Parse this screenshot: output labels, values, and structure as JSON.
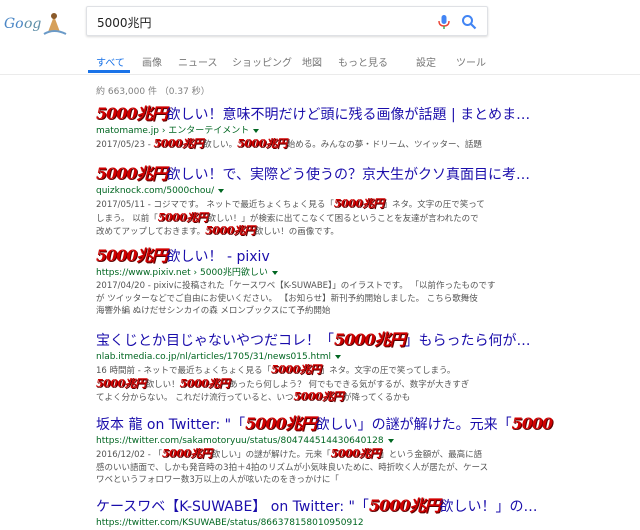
{
  "search": {
    "query": "5000兆円"
  },
  "tabs": [
    {
      "label": "すべて"
    },
    {
      "label": "画像"
    },
    {
      "label": "ニュース"
    },
    {
      "label": "ショッピング"
    },
    {
      "label": "地図"
    },
    {
      "label": "もっと見る"
    },
    {
      "label": "設定"
    },
    {
      "label": "ツール"
    }
  ],
  "stats": "約 663,000 件 （0.37 秒）",
  "results": [
    {
      "title_hl": "5000兆円",
      "title_rest": "欲しい！意味不明だけど頭に残る画像が話題 | まとめま…",
      "url": "matomame.jp › エンターテイメント",
      "snip1_pre": "2017/05/23 - ",
      "snip1_hl": "5000兆円",
      "snip1_mid": "欲しい。",
      "snip1_hl2": "5000兆円",
      "snip1_post": "始める。みんなの夢・ドリーム、ツイッター、話題"
    },
    {
      "title_hl": "5000兆円",
      "title_rest": "欲しい！で、実際どう使うの？京大生がクソ真面目に考…",
      "url": "quizknock.com/5000chou/",
      "snip1": "2017/05/11 - コジマです。 ネットで最近ちょくちょく見る「",
      "snip1_hl": "5000兆円",
      "snip1_post": "」ネタ。文字の圧で笑って",
      "snip2": "しまう。 以前「",
      "snip2_hl": "5000兆円",
      "snip2_post": "欲しい！」が検索に出てこなくて困るということを友達が言われたので",
      "snip3": "改めてアップしておきます。",
      "snip3_hl": "5000兆円",
      "snip3_post": "欲しい！の画像です。"
    },
    {
      "title_hl": "5000兆円",
      "title_rest": "欲しい！ - pixiv",
      "url": "https://www.pixiv.net › 5000兆円欲しい",
      "snip1": "2017/04/20 - pixivに投稿された「ケースワベ【K-SUWABE】」のイラストです。 「以前作ったものです",
      "snip2": "が ツイッターなどでご自由にお使いください。 【お知らせ】新刊予約開始しました。 こちら歌舞伎",
      "snip3": "海響外編 ぬけだせシンカイの森 メロンブックスにて予約開始"
    },
    {
      "title_pre": "宝くじとか目じゃないやつだコレ！「",
      "title_hl": "5000兆円",
      "title_rest": "」もらったら何が…",
      "url": "nlab.itmedia.co.jp/nl/articles/1705/31/news015.html",
      "snip1": "16 時間前 - ネットで最近ちょくちょく見る「",
      "snip1_hl": "5000兆円",
      "snip1_post": "」ネタ。文字の圧で笑ってしまう。",
      "snip2_hl": "5000兆円",
      "snip2_mid": "欲しい！",
      "snip2_hl2": "5000兆円",
      "snip2_post": "あったら何しよう？ 何でもできる気がするが、数字が大きすぎ",
      "snip3": "てよく分からない。 これだけ流行っていると、いつ",
      "snip3_hl": "5000兆円",
      "snip3_post": "が降ってくるかも"
    },
    {
      "title_pre": "坂本 龍 on Twitter: \"「",
      "title_hl": "5000兆円",
      "title_rest": "欲しい」の謎が解けた。元来「",
      "title_hl2": "5000",
      "url": "https://twitter.com/sakamotoryuu/status/804744514430640128",
      "snip1": "2016/12/02 - 「",
      "snip1_hl": "5000兆円",
      "snip1_post": "欲しい」の謎が解けた。元来「",
      "snip1_hl2": "5000兆円",
      "snip1_post2": "」という金額が、最高に語",
      "snip2": "感のいい語面で、しかも発音時の3拍＋4拍のリズムが小気味良いために、時折吹く人が居たが、ケース",
      "snip3": "ワベというフォロワー数3万以上の人が呟いたのをきっかけに「"
    },
    {
      "title_pre": "ケースワベ【K-SUWABE】 on Twitter: \"「",
      "title_hl": "5000兆円",
      "title_rest": "欲しい！」の…",
      "url": "https://twitter.com/KSUWABE/status/866378158010950912"
    }
  ]
}
